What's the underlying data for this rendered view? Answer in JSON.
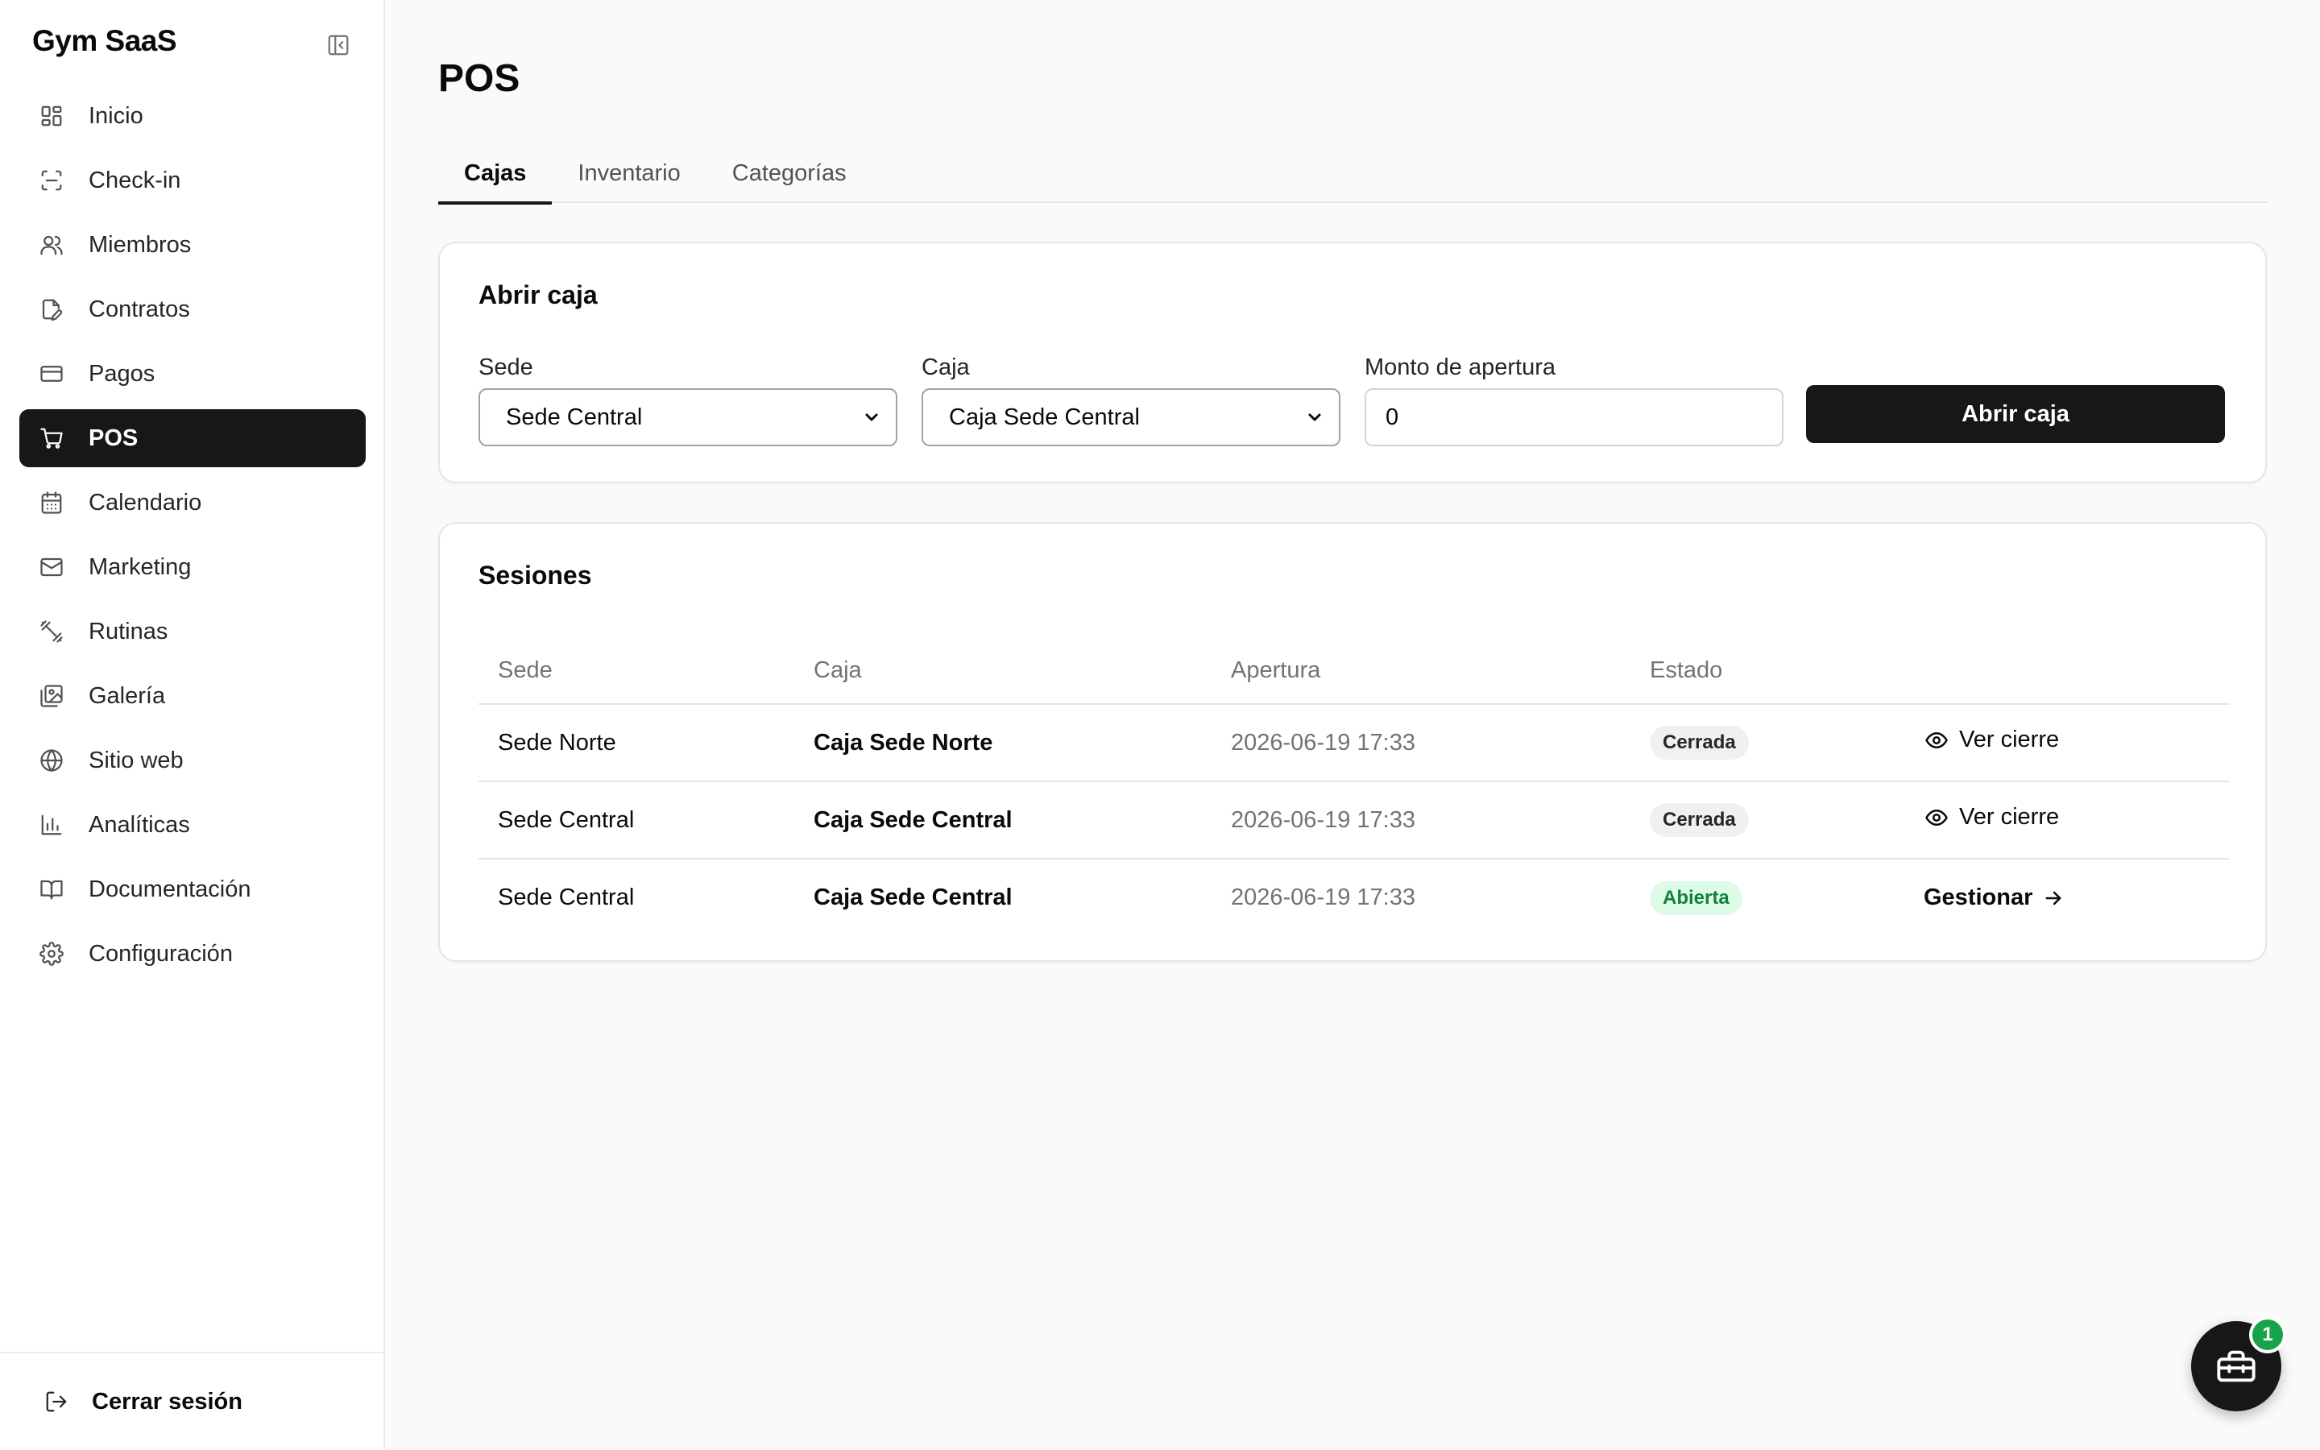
{
  "app": {
    "brand": "Gym SaaS"
  },
  "sidebar": {
    "items": [
      {
        "label": "Inicio",
        "icon": "grid-icon"
      },
      {
        "label": "Check-in",
        "icon": "scan-icon"
      },
      {
        "label": "Miembros",
        "icon": "users-icon"
      },
      {
        "label": "Contratos",
        "icon": "file-edit-icon"
      },
      {
        "label": "Pagos",
        "icon": "credit-card-icon"
      },
      {
        "label": "POS",
        "icon": "shopping-cart-icon",
        "active": true
      },
      {
        "label": "Calendario",
        "icon": "calendar-icon"
      },
      {
        "label": "Marketing",
        "icon": "mail-icon"
      },
      {
        "label": "Rutinas",
        "icon": "dumbbell-icon"
      },
      {
        "label": "Galería",
        "icon": "gallery-icon"
      },
      {
        "label": "Sitio web",
        "icon": "globe-icon"
      },
      {
        "label": "Analíticas",
        "icon": "bar-chart-icon"
      },
      {
        "label": "Documentación",
        "icon": "book-icon"
      },
      {
        "label": "Configuración",
        "icon": "gear-icon"
      }
    ],
    "logout_label": "Cerrar sesión"
  },
  "page": {
    "title": "POS",
    "tabs": [
      "Cajas",
      "Inventario",
      "Categorías"
    ],
    "active_tab": "Cajas"
  },
  "open_register": {
    "title": "Abrir caja",
    "sede_label": "Sede",
    "sede_value": "Sede Central",
    "caja_label": "Caja",
    "caja_value": "Caja Sede Central",
    "monto_label": "Monto de apertura",
    "monto_value": "0",
    "submit_label": "Abrir caja"
  },
  "sessions": {
    "title": "Sesiones",
    "columns": [
      "Sede",
      "Caja",
      "Apertura",
      "Estado"
    ],
    "rows": [
      {
        "sede": "Sede Norte",
        "caja": "Caja Sede Norte",
        "apertura": "2026-06-19 17:33",
        "estado": "Cerrada",
        "action": "Ver cierre"
      },
      {
        "sede": "Sede Central",
        "caja": "Caja Sede Central",
        "apertura": "2026-06-19 17:33",
        "estado": "Cerrada",
        "action": "Ver cierre"
      },
      {
        "sede": "Sede Central",
        "caja": "Caja Sede Central",
        "apertura": "2026-06-19 17:33",
        "estado": "Abierta",
        "action": "Gestionar"
      }
    ]
  },
  "fab": {
    "badge_count": "1",
    "icon": "toolbox-icon"
  },
  "colors": {
    "active_nav_bg": "#171717",
    "primary_button": "#171717",
    "badge_closed_bg": "#f0f0f0",
    "badge_open_bg": "#dcfce7",
    "badge_open_text": "#15803d",
    "fab_badge": "#16a34a"
  }
}
